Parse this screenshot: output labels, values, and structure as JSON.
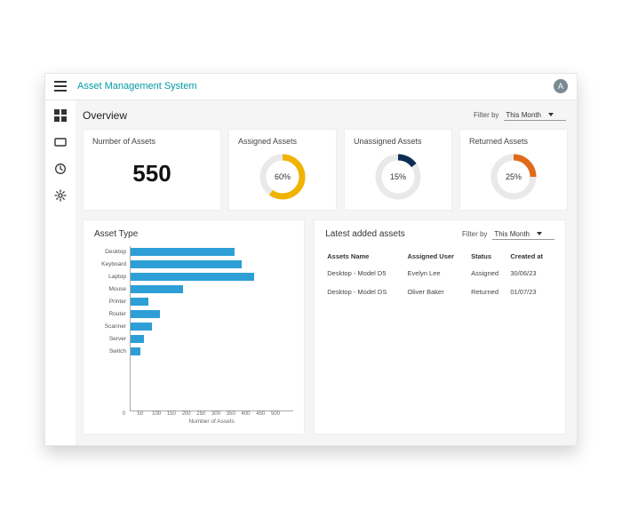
{
  "app": {
    "title": "Asset Management System",
    "avatar_letter": "A"
  },
  "page": {
    "title": "Overview",
    "filter_label": "Filter by",
    "filter_value": "This Month"
  },
  "stats": {
    "number_of_assets": {
      "label": "Number of Assets",
      "value": "550"
    },
    "assigned": {
      "label": "Assigned Assets",
      "pct": 60,
      "pct_label": "60%",
      "color": "#f0b400"
    },
    "unassigned": {
      "label": "Unassigned Assets",
      "pct": 15,
      "pct_label": "15%",
      "color": "#0b2e52"
    },
    "returned": {
      "label": "Returned Assets",
      "pct": 25,
      "pct_label": "25%",
      "color": "#e06a1a"
    }
  },
  "latest_panel": {
    "title": "Latest added assets",
    "filter_label": "Filter by",
    "filter_value": "This Month",
    "columns": [
      "Assets Name",
      "Assigned User",
      "Status",
      "Created at"
    ],
    "rows": [
      {
        "name": "Desktop - Model D5",
        "user": "Evelyn Lee",
        "status": "Assigned",
        "created": "30/06/23"
      },
      {
        "name": "Desktop - Model DS",
        "user": "Oliver Baker",
        "status": "Returned",
        "created": "01/07/23"
      }
    ]
  },
  "chart_data": {
    "type": "bar",
    "title": "Asset Type",
    "xlabel": "Number of Assets",
    "ylabel": "",
    "xlim": [
      0,
      500
    ],
    "xticks": [
      0,
      50,
      100,
      150,
      200,
      250,
      300,
      350,
      400,
      450,
      500
    ],
    "categories": [
      "Desktop",
      "Keyboard",
      "Laptop",
      "Mouse",
      "Printer",
      "Router",
      "Scanner",
      "Server",
      "Switch"
    ],
    "values": [
      320,
      340,
      380,
      160,
      55,
      90,
      65,
      40,
      30
    ]
  }
}
